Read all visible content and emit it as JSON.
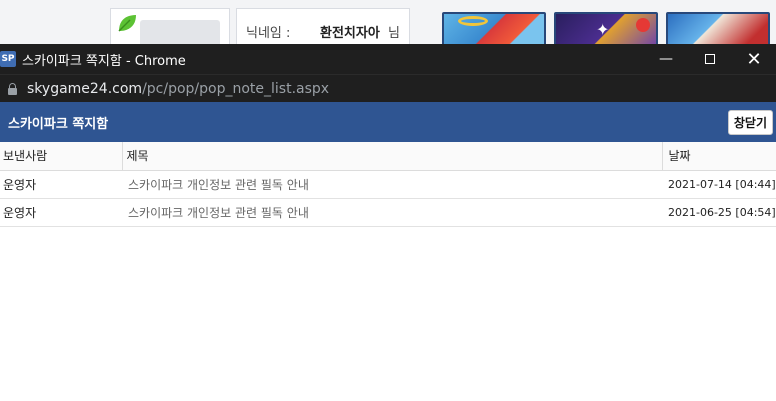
{
  "background": {
    "nickname_label": "닉네임 :",
    "nickname_value": "환전치자아",
    "nickname_suffix": "님"
  },
  "window": {
    "app_icon_text": "SP",
    "title": "스카이파크 쪽지함 - Chrome",
    "controls": {
      "minimize": "—",
      "close": "✕"
    }
  },
  "address": {
    "host": "skygame24.com",
    "path": "/pc/pop/pop_note_list.aspx"
  },
  "page": {
    "title": "스카이파크 쪽지함",
    "close_label": "창닫기"
  },
  "table": {
    "headers": [
      "보낸사람",
      "제목",
      "날짜"
    ],
    "rows": [
      {
        "sender": "운영자",
        "subject": "스카이파크 개인정보 관련 필독 안내",
        "date": "2021-07-14 [04:44]"
      },
      {
        "sender": "운영자",
        "subject": "스카이파크 개인정보 관련 필독 안내",
        "date": "2021-06-25 [04:54]"
      }
    ]
  },
  "colors": {
    "header_bg": "#2f5592",
    "titlebar_bg": "#1f1f1f",
    "tile_border": "#28487a"
  }
}
